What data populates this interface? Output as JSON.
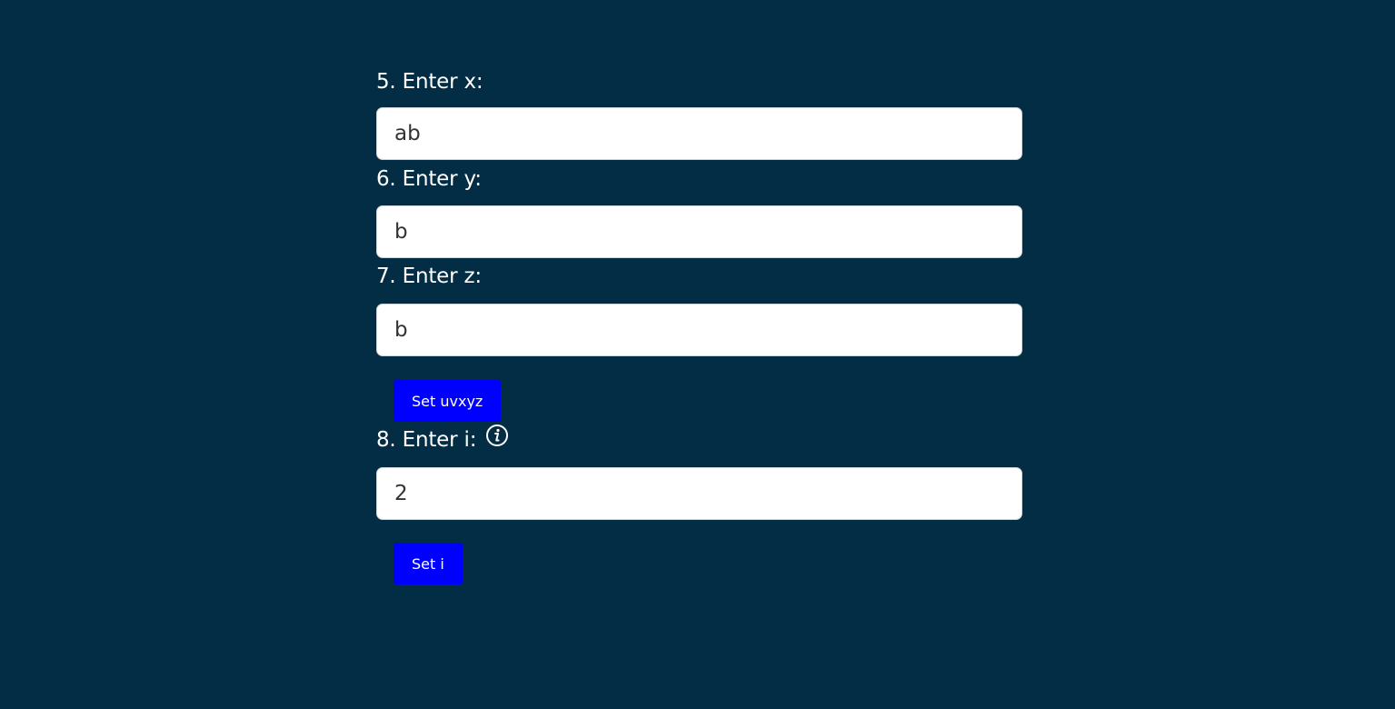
{
  "form": {
    "x_label": "5. Enter x:",
    "x_value": "ab",
    "y_label": "6. Enter y:",
    "y_value": "b",
    "z_label": "7. Enter z:",
    "z_value": "b",
    "set_uvxyz_label": "Set uvxyz",
    "i_label": "8. Enter i:",
    "i_info_icon": "info-icon",
    "i_value": "2",
    "set_i_label": "Set i"
  },
  "colors": {
    "background": "#022d44",
    "button": "#0000ff",
    "label_text": "#ffffff",
    "input_text": "#333333"
  }
}
